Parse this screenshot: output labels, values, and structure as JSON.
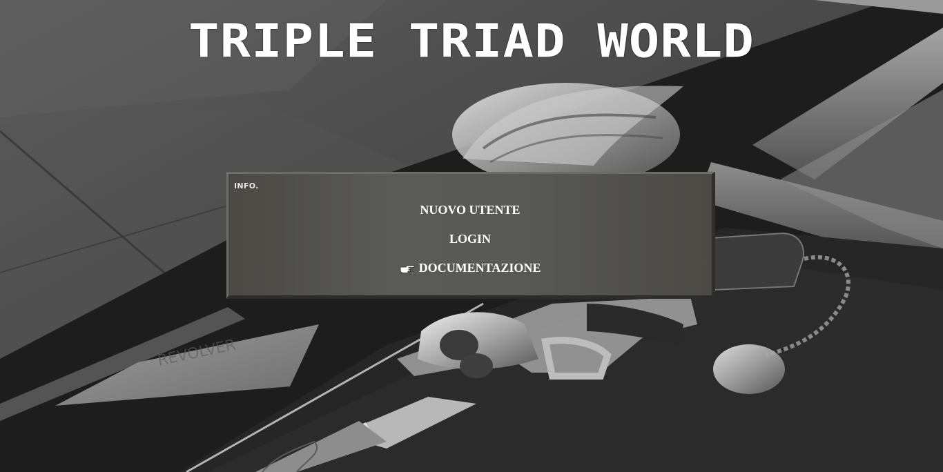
{
  "header": {
    "title": "TRIPLE TRIAD WORLD"
  },
  "info_panel": {
    "heading": "INFO.",
    "menu": [
      {
        "label": "NUOVO UTENTE",
        "icon": ""
      },
      {
        "label": "LOGIN",
        "icon": ""
      },
      {
        "label": "DOCUMENTAZIONE",
        "icon": "pointing-hand-icon"
      }
    ]
  },
  "background": {
    "description_colors": {
      "panel_left": "#4a4944",
      "panel_mid": "#5a5a57",
      "text": "#ffffff"
    }
  }
}
